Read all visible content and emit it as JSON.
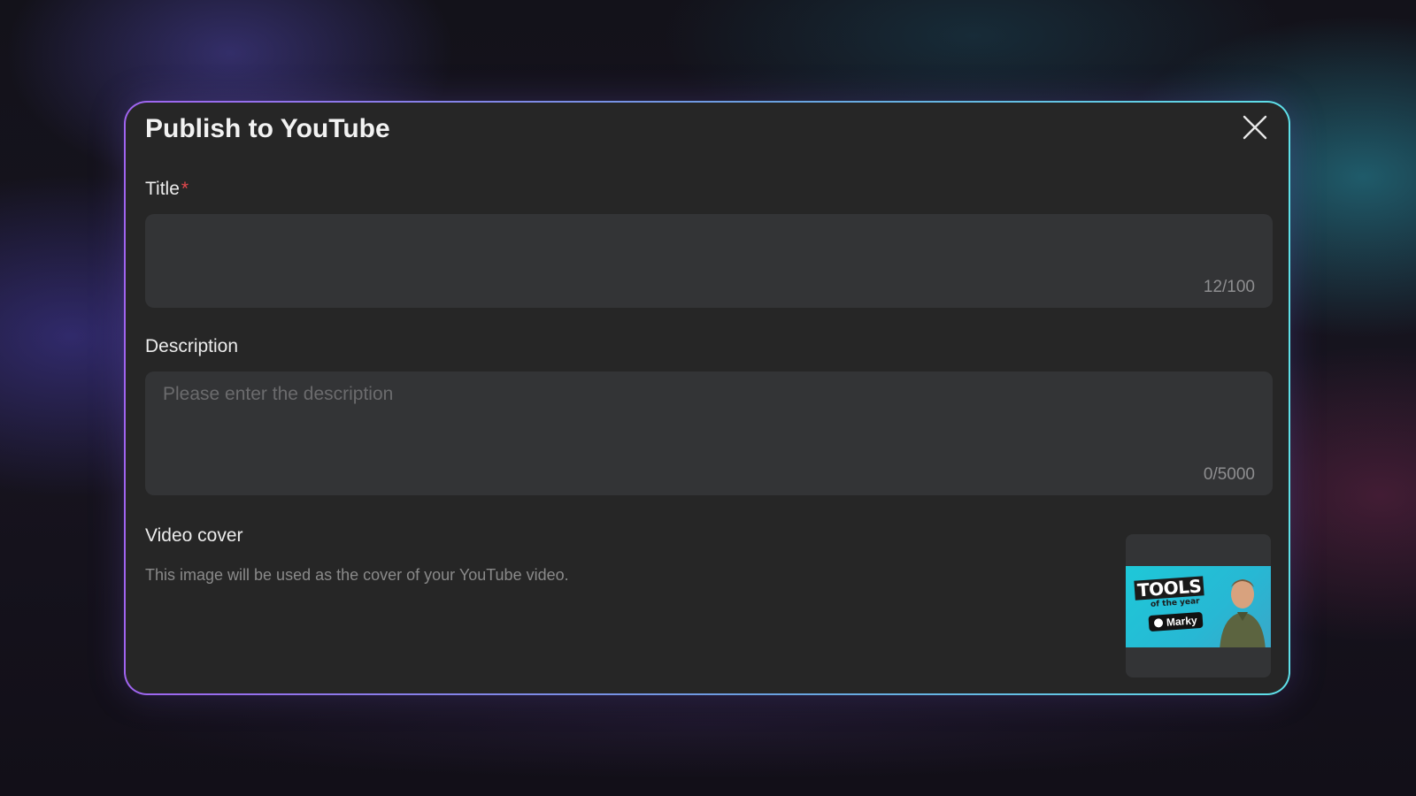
{
  "dialog": {
    "title": "Publish to YouTube"
  },
  "title_field": {
    "label": "Title",
    "required_mark": "*",
    "value": "",
    "counter": "12/100"
  },
  "description_field": {
    "label": "Description",
    "placeholder": "Please enter the description",
    "counter": "0/5000"
  },
  "video_cover": {
    "label": "Video cover",
    "helper_text": "This image will be used as the cover of your YouTube video.",
    "thumbnail": {
      "headline": "TOOLS",
      "subline": "of the year",
      "brand": "Marky"
    }
  },
  "colors": {
    "modal_bg": "#262626",
    "field_bg": "#333436",
    "border_gradient_start": "#a064f0",
    "border_gradient_end": "#5ee0e8",
    "required": "#e5484d"
  },
  "icons": {
    "close": "close-icon"
  }
}
